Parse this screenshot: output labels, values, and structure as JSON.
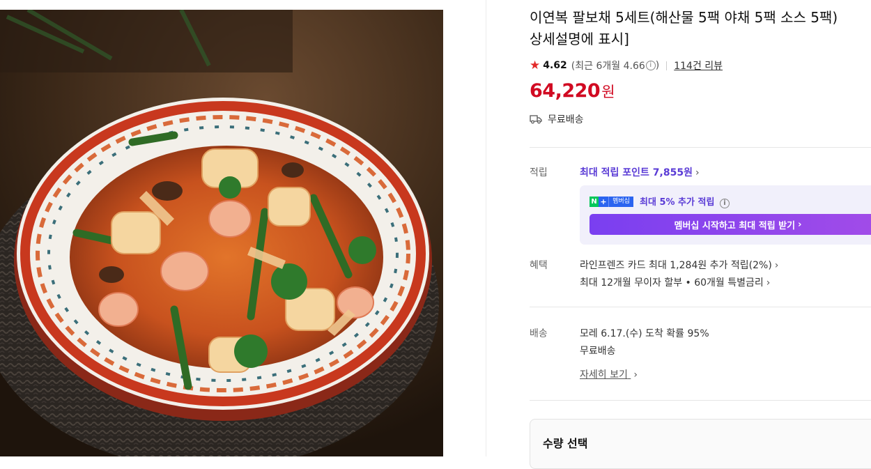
{
  "product": {
    "title_line1": "이연복 팔보채 5세트(해산물 5팩 야채 5팩 소스 5팩)",
    "title_line2": "상세설명에 표시]",
    "rating": "4.62",
    "recent_rating": "(최근 6개월 4.66",
    "recent_rating_close": ")",
    "reviews": "114건 리뷰",
    "price": "64,220",
    "currency": "원",
    "shipping": "무료배송",
    "image_icon": "stir-fry-seafood-dish-photo"
  },
  "points": {
    "label": "적립",
    "max_link": "최대 적립 포인트 7,855원",
    "badge_n": "N",
    "badge_plus": "+",
    "badge_member": "멤버십",
    "member_text": "최대 5% 추가 적립",
    "member_button": "멤버십 시작하고 최대 적립 받기"
  },
  "benefits": {
    "label": "혜택",
    "card": "라인프렌즈 카드 최대 1,284원 추가 적립(2%)",
    "installment": "최대 12개월 무이자 할부 • 60개월 특별금리"
  },
  "delivery": {
    "label": "배송",
    "arrival": "모레 6.17.(수) 도착 확률 95%",
    "fee": "무료배송",
    "detail_link": "자세히 보기"
  },
  "quantity": {
    "title": "수량 선택"
  },
  "colors": {
    "price": "#d10a22",
    "accent": "#5a3bd6",
    "star": "#e22828"
  },
  "icons": {
    "star": "star-icon",
    "info": "info-icon",
    "truck": "truck-icon",
    "chevron": "chevron-right-icon"
  }
}
